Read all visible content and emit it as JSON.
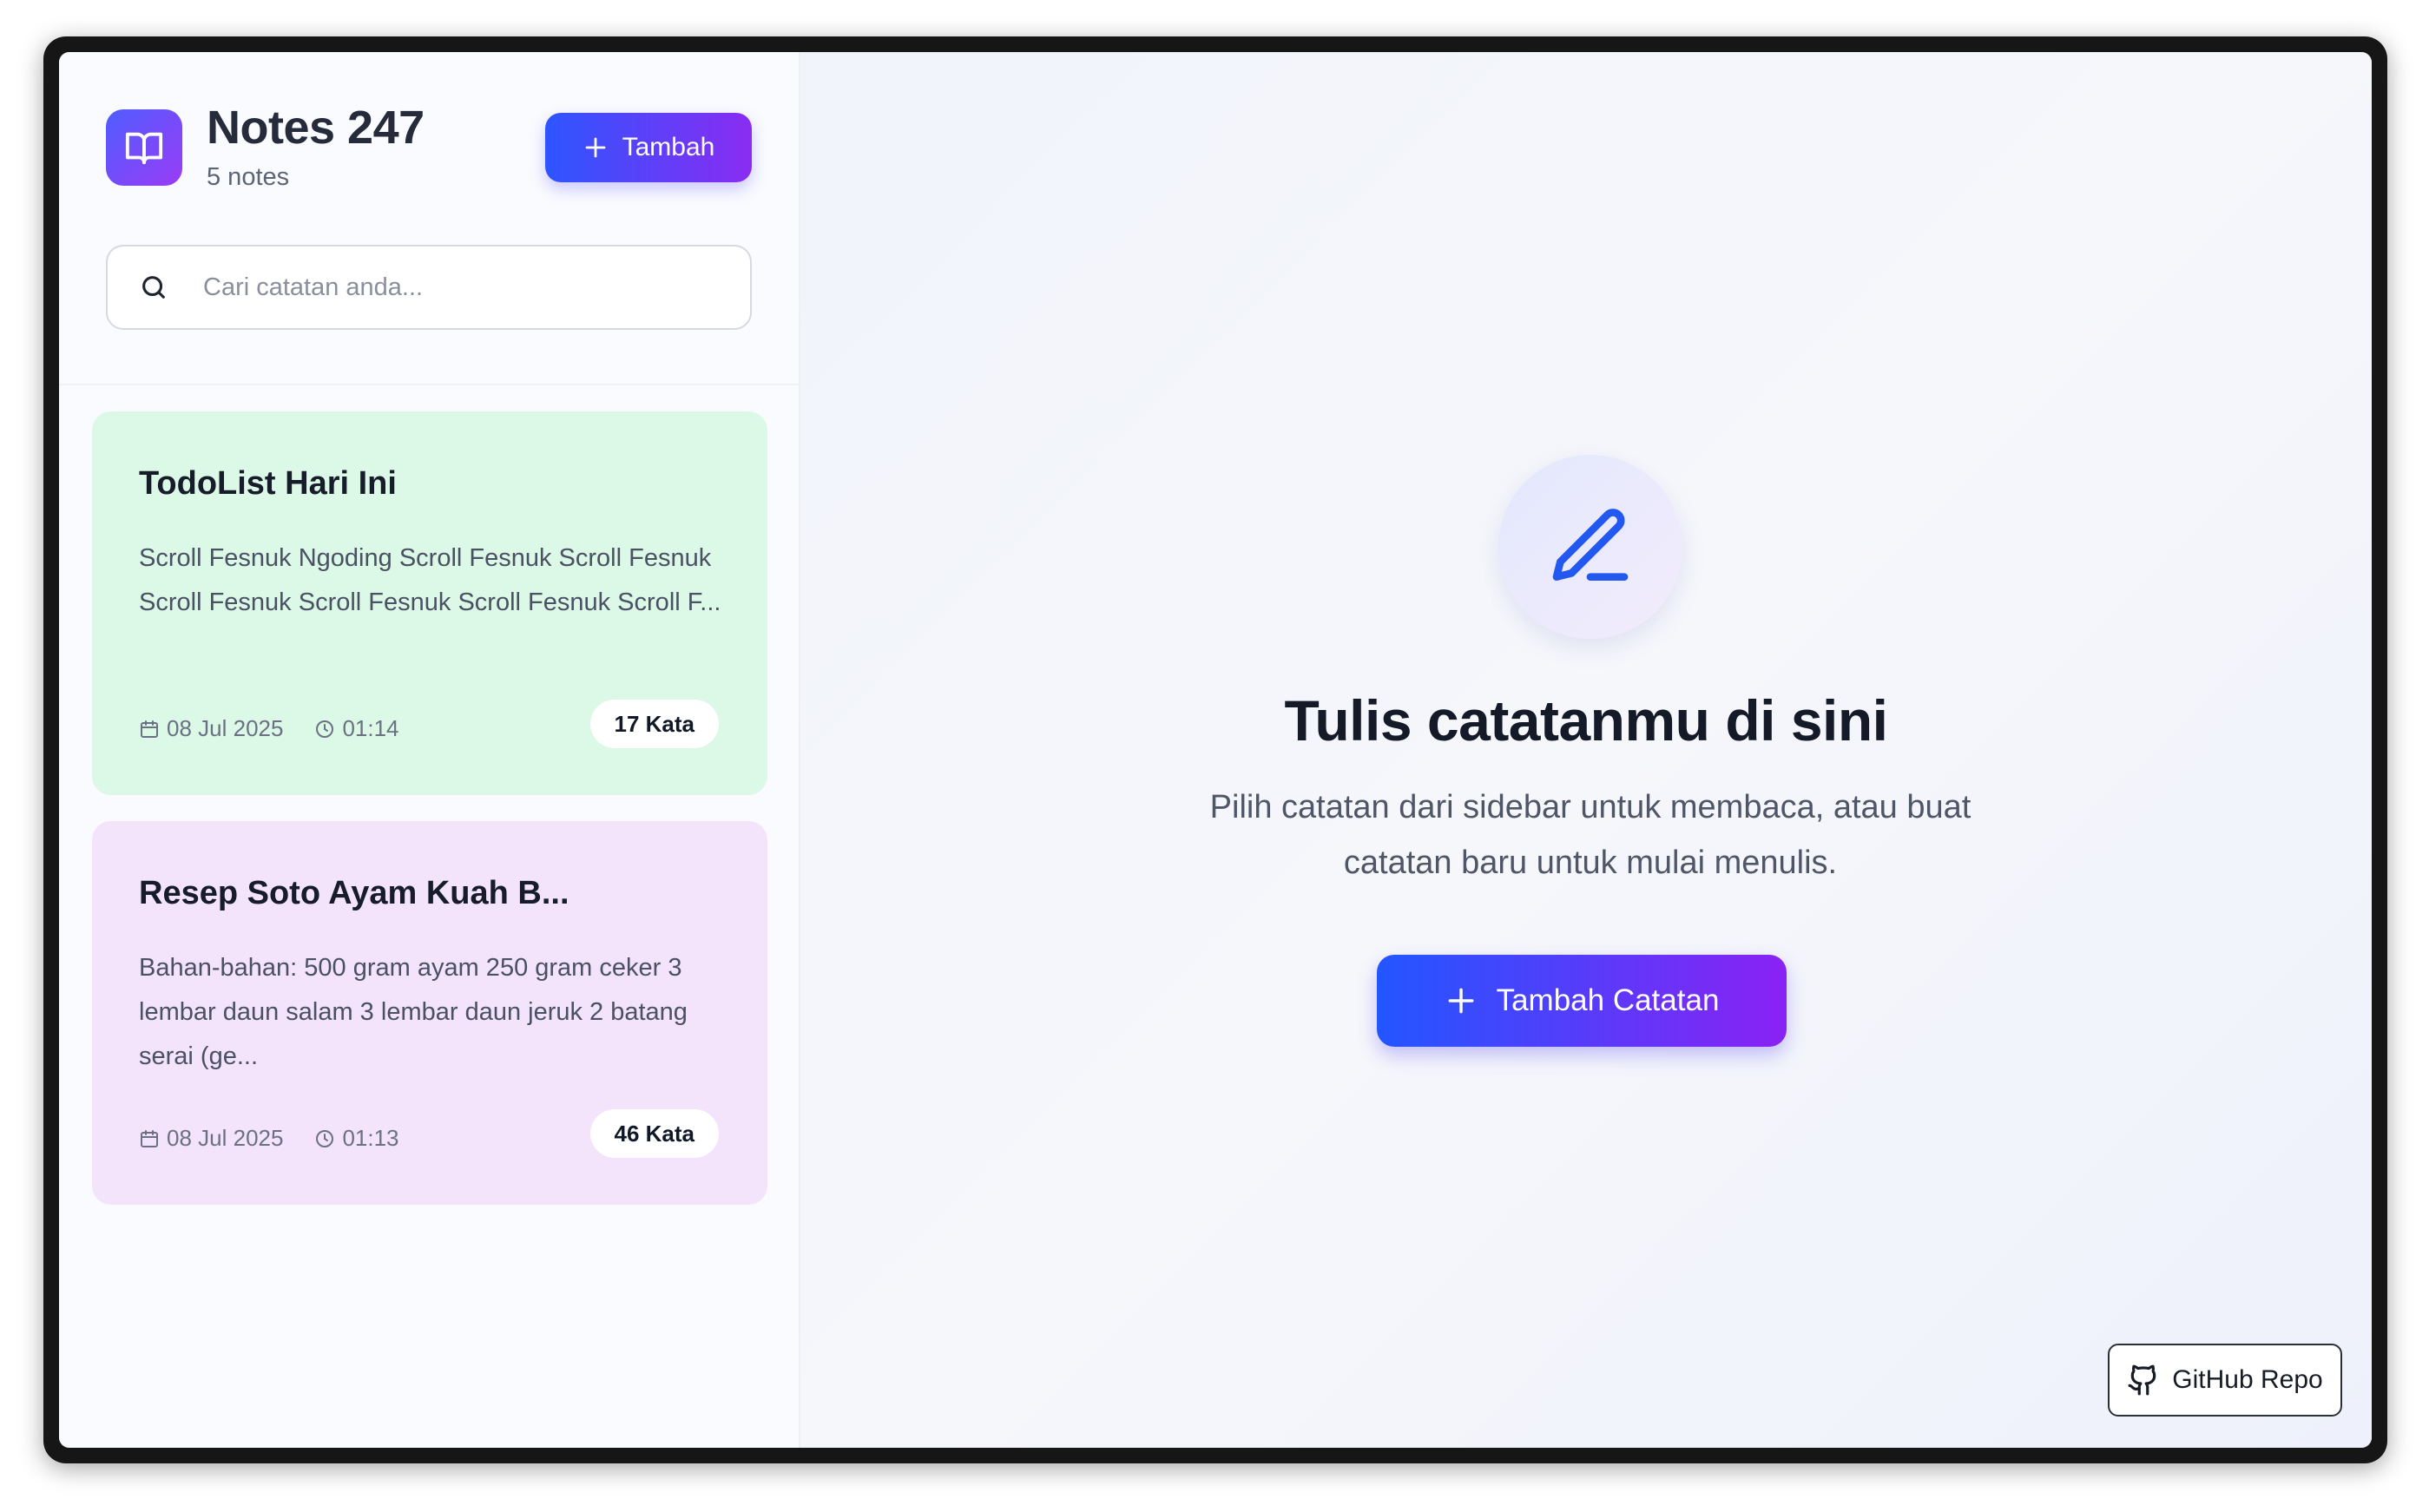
{
  "sidebar": {
    "app_title": "Notes 247",
    "note_count": "5 notes",
    "add_button_label": "Tambah",
    "search_placeholder": "Cari catatan anda...",
    "notes": [
      {
        "title": "TodoList Hari Ini",
        "excerpt": "Scroll Fesnuk Ngoding Scroll Fesnuk Scroll Fesnuk Scroll Fesnuk Scroll Fesnuk Scroll Fesnuk Scroll F...",
        "date": "08 Jul 2025",
        "time": "01:14",
        "word_count": "17 Kata",
        "color": "#dcf8e6"
      },
      {
        "title": "Resep Soto Ayam Kuah B...",
        "excerpt": "Bahan-bahan: 500 gram ayam 250 gram ceker 3 lembar daun salam 3 lembar daun jeruk 2 batang serai (ge...",
        "date": "08 Jul 2025",
        "time": "01:13",
        "word_count": "46 Kata",
        "color": "#f3e3fb"
      }
    ]
  },
  "main": {
    "empty_title": "Tulis catatanmu di sini",
    "empty_description": "Pilih catatan dari sidebar untuk membaca, atau buat catatan baru untuk mulai menulis.",
    "add_note_button_label": "Tambah Catatan",
    "github_button_label": "GitHub Repo"
  },
  "colors": {
    "accent_start": "#2d55ff",
    "accent_end": "#8a2cf2"
  },
  "icons": [
    "book-open-icon",
    "plus-icon",
    "search-icon",
    "calendar-icon",
    "clock-icon",
    "pen-icon",
    "github-icon"
  ]
}
